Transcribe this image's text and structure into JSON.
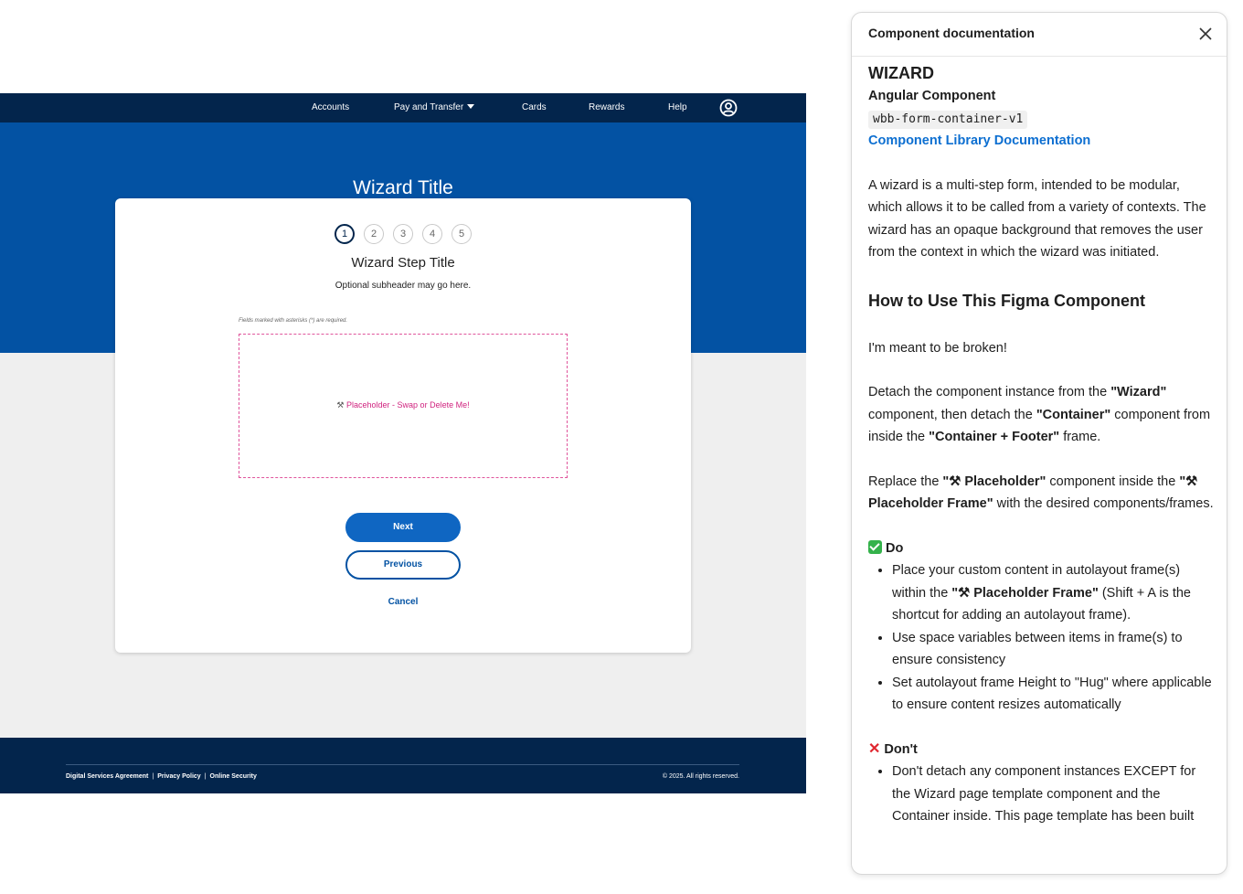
{
  "nav": {
    "items": [
      "Accounts",
      "Pay and Transfer",
      "Cards",
      "Rewards",
      "Help"
    ],
    "icons": {
      "dropdown": "caret-down-icon",
      "profile": "user-circle-icon"
    }
  },
  "hero": {
    "title": "Wizard Title"
  },
  "card": {
    "steps": [
      "1",
      "2",
      "3",
      "4",
      "5"
    ],
    "active_step": 1,
    "step_title": "Wizard Step Title",
    "subheader": "Optional subheader may go here.",
    "required_note": "Fields marked with asterisks (*) are required.",
    "placeholder_icon": "⚒",
    "placeholder_label": "Placeholder -",
    "placeholder_action": "Swap or Delete Me!",
    "next_label": "Next",
    "previous_label": "Previous",
    "cancel_label": "Cancel"
  },
  "footer": {
    "links": [
      "Digital Services Agreement",
      "Privacy Policy",
      "Online Security"
    ],
    "separator": "|",
    "copyright": "© 2025. All rights reserved."
  },
  "doc": {
    "header_title": "Component documentation",
    "heading": "WIZARD",
    "angular_label": "Angular Component",
    "component_code": "wbb-form-container-v1",
    "library_link": "Component Library Documentation",
    "intro": "A wizard is a multi-step form, intended to be modular, which allows it to be called from a variety of contexts. The wizard has an opaque background that removes the user from the context in which the wizard was initiated.",
    "how_to_heading": "How to Use This Figma Component",
    "broken_note": "I'm meant to be broken!",
    "detach_p1": "Detach the component instance from the ",
    "detach_b1": "\"Wizard\"",
    "detach_p2": " component, then detach the ",
    "detach_b2": "\"Container\"",
    "detach_p3": " component from inside the ",
    "detach_b3": "\"Container + Footer\"",
    "detach_p4": " frame.",
    "replace_p1": "Replace the ",
    "replace_b1": "\"⚒ Placeholder\"",
    "replace_p2": " component inside the ",
    "replace_b2": "\"⚒ Placeholder Frame\"",
    "replace_p3": " with the desired components/frames.",
    "do_heading": "Do",
    "do_item1_p1": "Place your custom content in autolayout frame(s) within the ",
    "do_item1_b": "\"⚒ Placeholder Frame\"",
    "do_item1_p2": " (Shift + A is the shortcut for adding an autolayout frame).",
    "do_item2": "Use space variables between items in frame(s) to ensure consistency",
    "do_item3": "Set autolayout frame Height to \"Hug\" where applicable to ensure content resizes automatically",
    "dont_heading": "Don't",
    "dont_item1": "Don't detach any component instances EXCEPT for the Wizard page template component and the Container inside. This page template has been built"
  }
}
